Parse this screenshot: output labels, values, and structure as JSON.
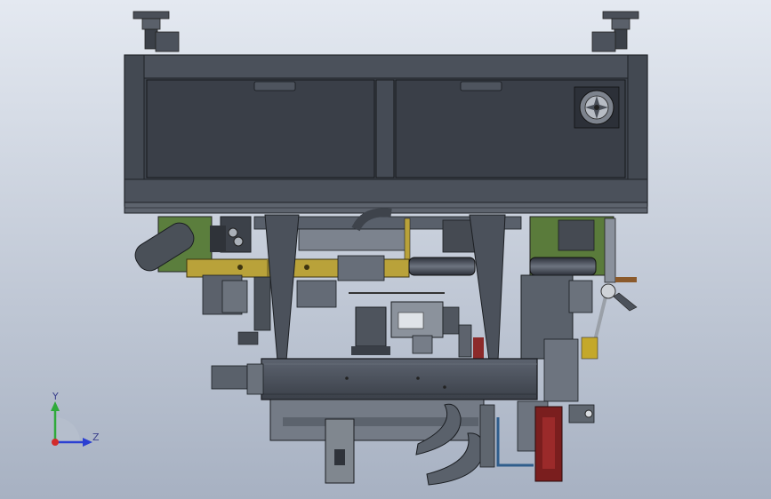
{
  "colors": {
    "bg_top": "#dfe5ef",
    "bg_bottom": "#a9b3c4",
    "steel_dark": "#3c424c",
    "steel_mid": "#5a6270",
    "steel_light": "#8a919c",
    "panel": "#474d57",
    "accent_green": "#55753b",
    "accent_yellow": "#b9a23a",
    "accent_red": "#7a1e1e",
    "accent_blue": "#2f5d8c",
    "axis_x": "#d22b2b",
    "axis_y": "#2faa3a",
    "axis_z": "#2b3fd2"
  },
  "view": {
    "triad": {
      "x_label": "",
      "y_label": "Y",
      "z_label": "Z"
    }
  },
  "icons": {
    "fan": "fan-icon",
    "triad": "axis-triad-icon"
  }
}
